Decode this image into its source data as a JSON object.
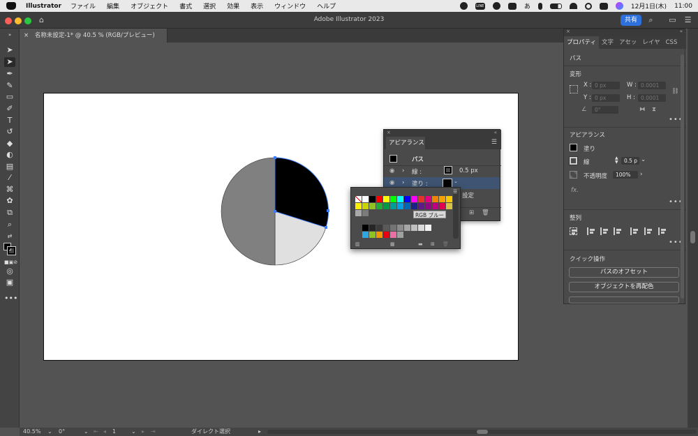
{
  "menubar": {
    "app_name": "Illustrator",
    "items": [
      "ファイル",
      "編集",
      "オブジェクト",
      "書式",
      "選択",
      "効果",
      "表示",
      "ウィンドウ",
      "ヘルプ"
    ],
    "line_label": "LINE",
    "kana_label": "あ",
    "date": "12月1日(木)",
    "time": "11:00"
  },
  "window": {
    "title": "Adobe Illustrator 2023",
    "share_label": "共有"
  },
  "document": {
    "tab_label": "名称未設定-1* @ 40.5 % (RGB/プレビュー)",
    "tab_close": "×"
  },
  "status": {
    "zoom": "40.5%",
    "rotation": "0°",
    "artboard_number": "1",
    "tool_name": "ダイレクト選択"
  },
  "properties": {
    "tabs": [
      "プロパティ",
      "文字",
      "アセッ",
      "レイヤ",
      "CSS"
    ],
    "section_path": "パス",
    "section_transform": "変形",
    "x_label": "X :",
    "y_label": "Y :",
    "w_label": "W :",
    "h_label": "H :",
    "x_value": "0 px",
    "y_value": "0 px",
    "w_value": "0.0001",
    "h_value": "0.0001",
    "angle_value": "0°",
    "section_appearance": "アピアランス",
    "fill_label": "塗り",
    "stroke_label": "線",
    "stroke_weight": "0.5 p",
    "opacity_label": "不透明度",
    "opacity_value": "100%",
    "fx_label": "fx.",
    "section_align": "整列",
    "section_quick": "クイック操作",
    "offset_button": "パスのオフセット",
    "recolor_button": "オブジェクトを再配色"
  },
  "appearance_panel": {
    "title": "アピアランス",
    "path_label": "パス",
    "stroke_label": "線 :",
    "stroke_value": "0.5 px",
    "fill_label": "塗り :",
    "opacity_text": "設定"
  },
  "swatches": {
    "tooltip": "RGB ブルー",
    "colors": [
      "#ffffff",
      "#000000",
      "#ff0000",
      "#ffff00",
      "#00ff00",
      "#00ffff",
      "#0000ff",
      "#ff00ff",
      "#e6332a",
      "#e4007f",
      "#f08300",
      "#f5a200",
      "#f9c800",
      "#fff100",
      "#c9d400",
      "#8fc31f",
      "#22ac38",
      "#009944",
      "#009e96",
      "#00a0e9",
      "#0068b7",
      "#1d2088",
      "#601986",
      "#920783",
      "#be0081",
      "#e5004f",
      "#d7c447",
      "#a9a9a9",
      "#7b7b7b"
    ],
    "grays": [
      "#000000",
      "#262626",
      "#3b3b3b",
      "#595959",
      "#737373",
      "#8c8c8c",
      "#a6a6a6",
      "#bfbfbf",
      "#d9d9d9",
      "#f2f2f2"
    ],
    "bottom_row": [
      "#2ea7e0",
      "#8dc21f",
      "#f39800",
      "#e60012",
      "#eb6ea5",
      "#9fa0a0"
    ]
  },
  "pie": {
    "slice_colors": [
      "#000000",
      "#e0e0e0",
      "#808080"
    ]
  }
}
